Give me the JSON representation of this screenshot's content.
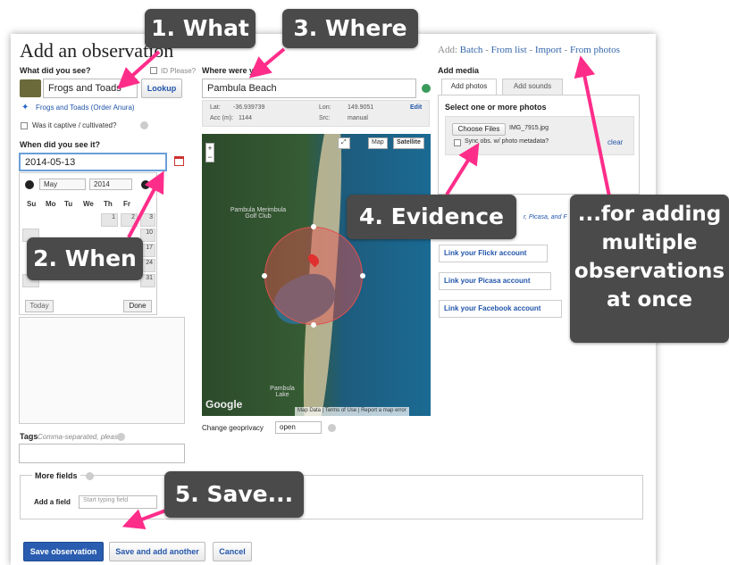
{
  "page": {
    "title": "Add an observation"
  },
  "add_links": {
    "prefix": "Add:",
    "items": [
      "Batch",
      "From list",
      "Import",
      "From photos"
    ],
    "separator": "-"
  },
  "what": {
    "label": "What did you see?",
    "id_please": "ID Please?",
    "value": "Frogs and Toads",
    "lookup": "Lookup",
    "taxon_link": "Frogs and Toads (Order Anura)",
    "captive": "Was it captive / cultivated?"
  },
  "when": {
    "label": "When did you see it?",
    "date_value": "2014-05-13",
    "calendar": {
      "month": "May",
      "year": "2014",
      "days_of_week": [
        "Su",
        "Mo",
        "Tu",
        "We",
        "Th",
        "Fr"
      ],
      "visible_days": [
        "1",
        "2",
        "3",
        "10",
        "17",
        "24",
        "31"
      ],
      "today": "Today",
      "done": "Done"
    }
  },
  "tags": {
    "label": "Tags",
    "hint": "Comma-separated, please"
  },
  "where": {
    "label": "Where were you?",
    "value": "Pambula Beach",
    "lat_label": "Lat:",
    "lat": "-36.939739",
    "lon_label": "Lon:",
    "lon": "149.9051",
    "acc_label": "Acc (m):",
    "acc": "1144",
    "src_label": "Src:",
    "src": "manual",
    "edit": "Edit",
    "map_labels": [
      "Pambula Merimbula Golf Club",
      "Pambula Lake"
    ],
    "map_buttons": [
      "Map",
      "Satellite"
    ],
    "google": "Google",
    "attribution": [
      "Map Data",
      "Terms of Use",
      "Report a map error"
    ],
    "geoprivacy_label": "Change geoprivacy",
    "geoprivacy_value": "open"
  },
  "media": {
    "label": "Add media",
    "tabs": [
      "Add photos",
      "Add sounds"
    ],
    "select_label": "Select one or more photos",
    "choose_files": "Choose Files",
    "file_name": "IMG_7915.jpg",
    "sync_label": "Sync obs. w/ photo metadata?",
    "clear": "clear",
    "partial_text": "r, Picasa, and F",
    "accounts": [
      "Link your Flickr account",
      "Link your Picasa account",
      "Link your Facebook account"
    ]
  },
  "more_fields": {
    "label": "More fields",
    "add_field_label": "Add a field",
    "add_field_placeholder": "Start typing field"
  },
  "actions": {
    "save": "Save observation",
    "save_another": "Save and add another",
    "cancel": "Cancel"
  },
  "callouts": {
    "what": "1. What",
    "when": "2. When",
    "where": "3. Where",
    "evidence": "4. Evidence",
    "save": "5. Save...",
    "batch": [
      "...for adding",
      "multiple",
      "observations",
      "at once"
    ]
  },
  "colors": {
    "callout_bg": "#4a4a4a",
    "arrow": "#ff2d8a",
    "link": "#2255aa",
    "primary": "#2a5db0"
  }
}
